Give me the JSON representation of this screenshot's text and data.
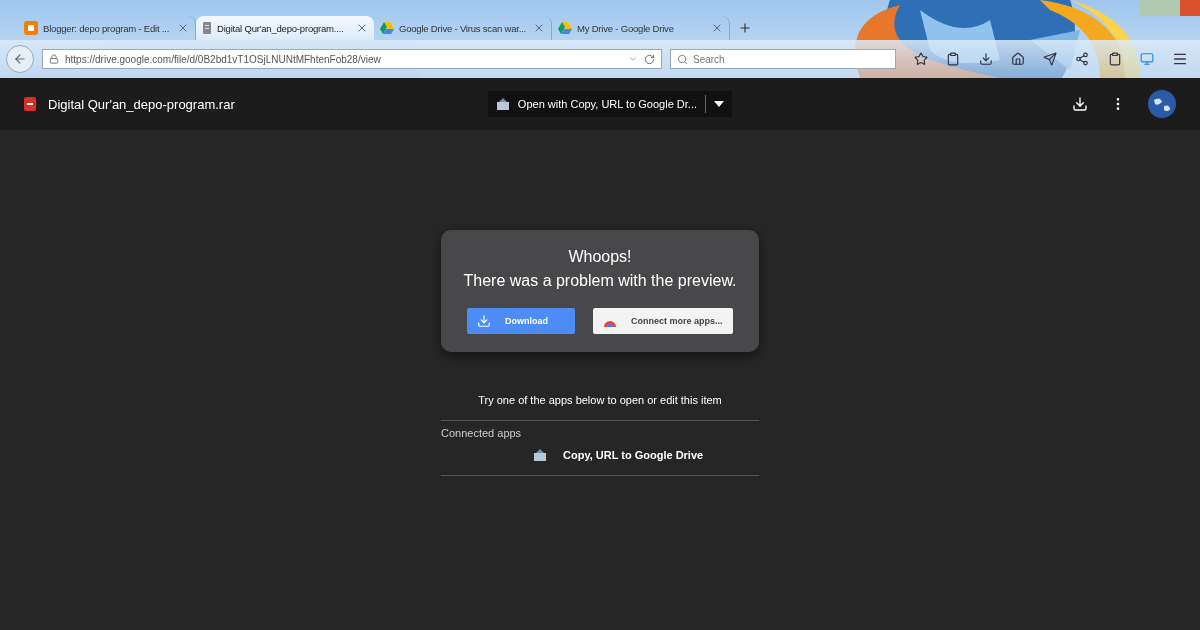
{
  "browser": {
    "tabs": [
      {
        "title": "Blogger: depo program - Edit ...",
        "kind": "blogger",
        "selected": false
      },
      {
        "title": "Digital Qur'an_depo-program....",
        "kind": "file",
        "selected": true
      },
      {
        "title": "Google Drive - Virus scan war...",
        "kind": "drive",
        "selected": false
      },
      {
        "title": "My Drive - Google Drive",
        "kind": "drive",
        "selected": false
      }
    ],
    "url": "https://drive.google.com/file/d/0B2bd1vT1OSjLNUNtMFhtenFob28/view",
    "search": {
      "placeholder": "Search"
    }
  },
  "viewer": {
    "file_name": "Digital Qur'an_depo-program.rar",
    "open_with": "Open with Copy, URL to Google Dr..."
  },
  "dialog": {
    "title": "Whoops!",
    "message": "There was a problem with the preview.",
    "buttons": [
      {
        "label": "Download",
        "kind": "primary"
      },
      {
        "label": "Connect more apps...",
        "kind": "secondary"
      }
    ]
  },
  "apps_hint": "Try one of the apps below to open or edit this item",
  "connected": {
    "label": "Connected apps",
    "apps": [
      {
        "name": "Copy, URL to Google Drive"
      }
    ]
  }
}
